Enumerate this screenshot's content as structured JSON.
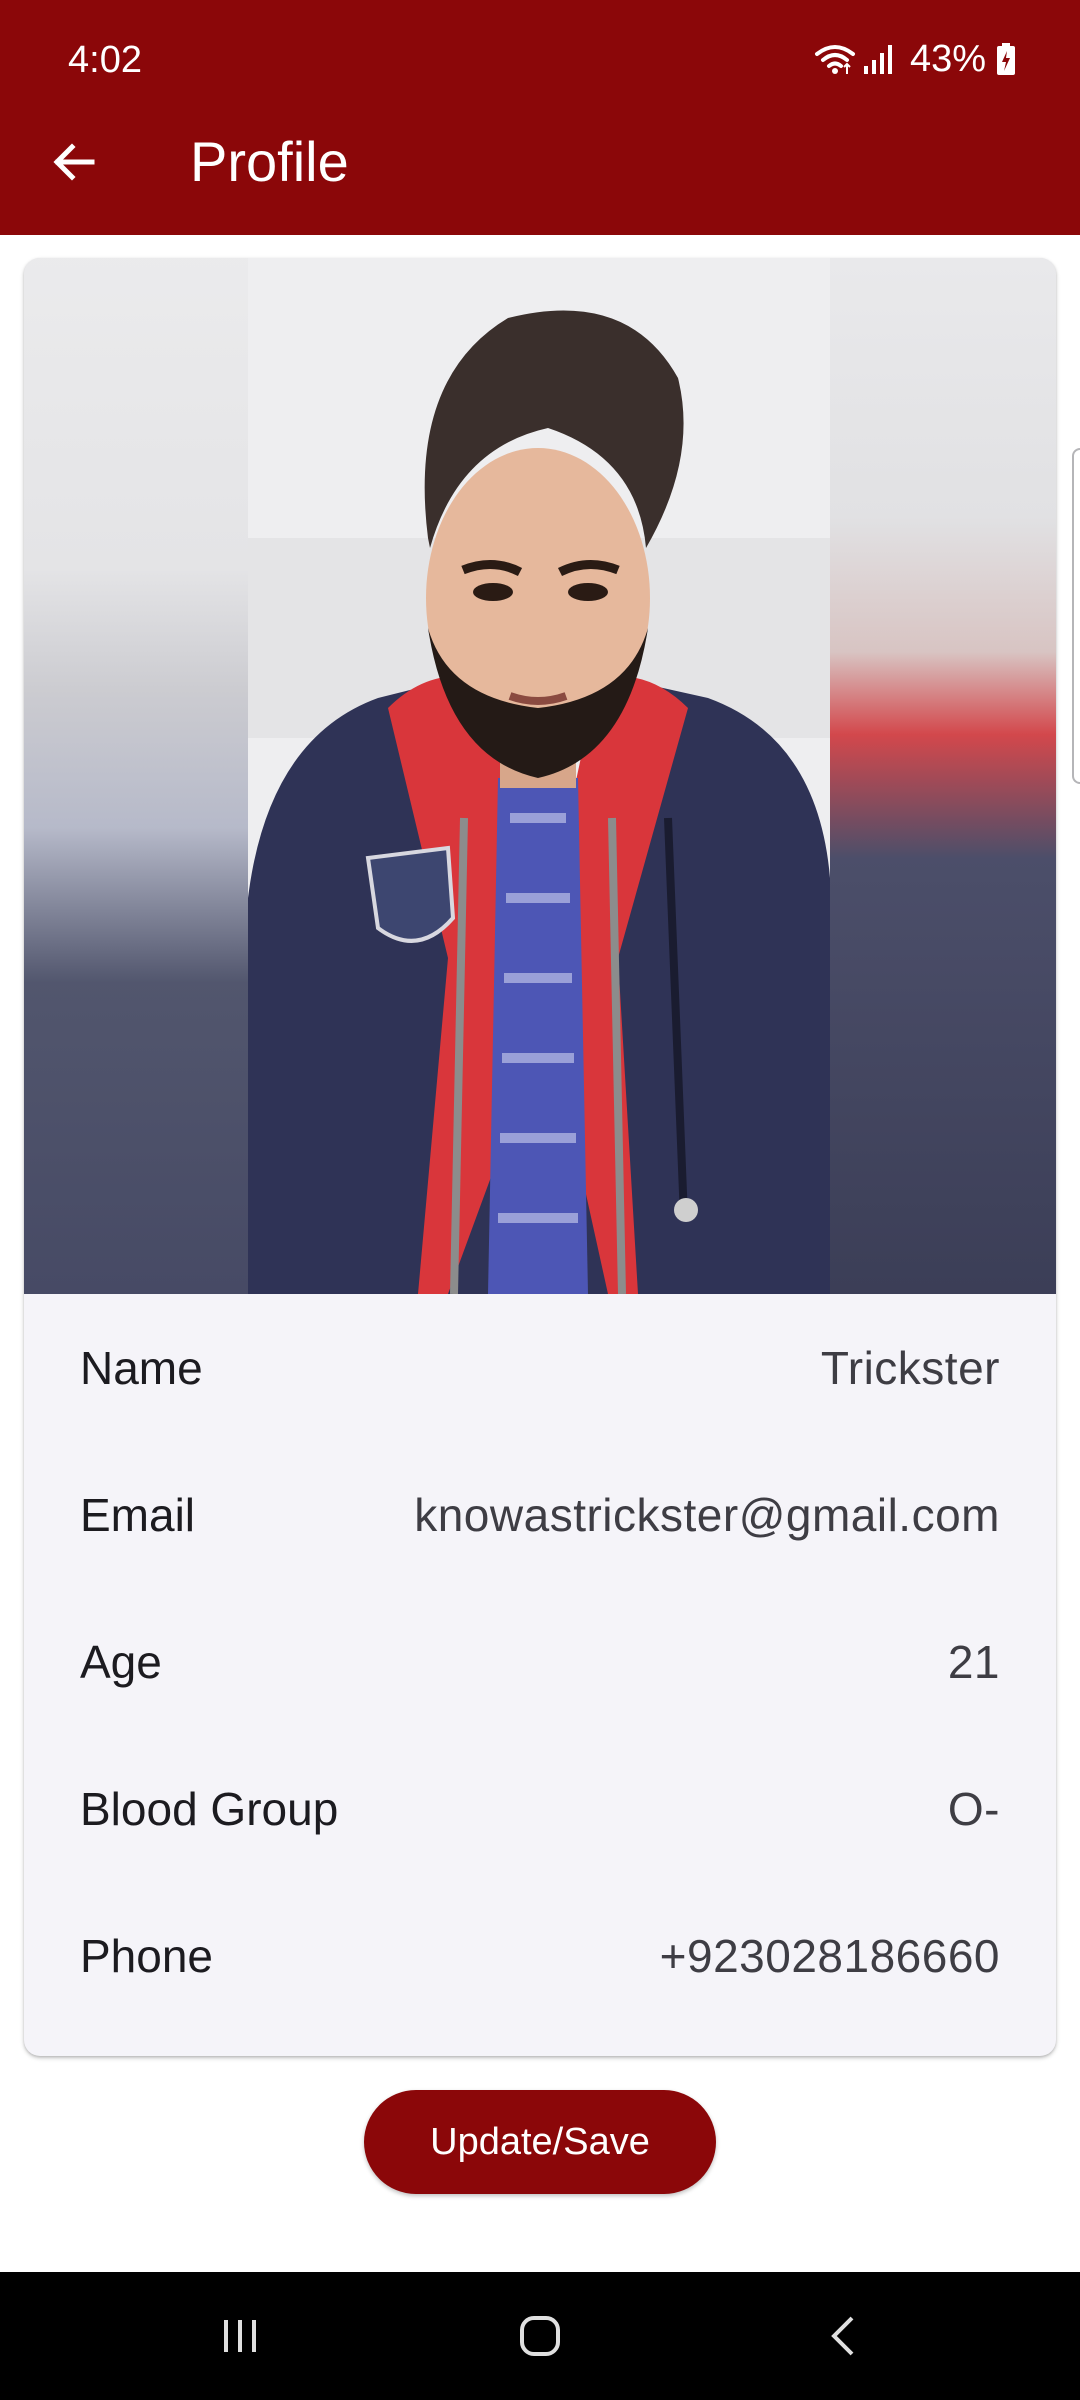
{
  "status_bar": {
    "time": "4:02",
    "battery_percent": "43%",
    "icons": [
      "wifi-icon",
      "signal-icon",
      "battery-charging-icon"
    ]
  },
  "toolbar": {
    "back_icon": "arrow-left-icon",
    "title": "Profile"
  },
  "profile": {
    "photo": "profile-photo",
    "fields": [
      {
        "label": "Name",
        "value": "Trickster"
      },
      {
        "label": "Email",
        "value": "knowastrickster@gmail.com"
      },
      {
        "label": "Age",
        "value": "21"
      },
      {
        "label": "Blood Group",
        "value": "O-"
      },
      {
        "label": "Phone",
        "value": "+923028186660"
      }
    ]
  },
  "actions": {
    "save_label": "Update/Save"
  },
  "nav_bar": {
    "icons": [
      "recent-apps-icon",
      "home-icon",
      "back-nav-icon"
    ]
  },
  "colors": {
    "primary": "#8b0709",
    "card_background": "#f5f4f9",
    "nav_background": "#000000"
  }
}
